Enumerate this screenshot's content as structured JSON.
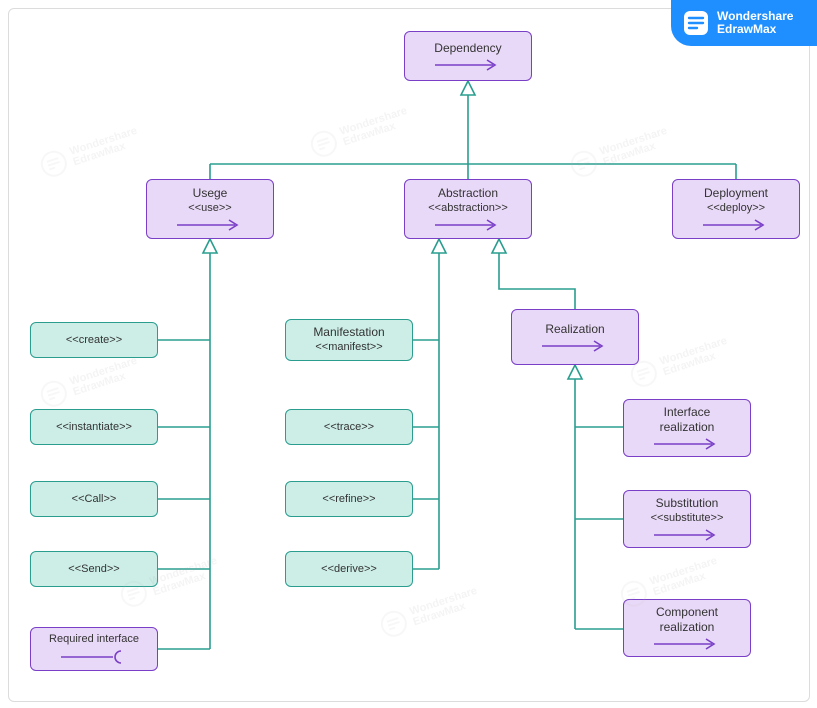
{
  "brand": {
    "line1": "Wondershare",
    "line2": "EdrawMax"
  },
  "watermark": {
    "line1": "Wondershare",
    "line2": "EdrawMax"
  },
  "colors": {
    "purpleFill": "#e9d9f8",
    "purpleStroke": "#7a3fc7",
    "tealFill": "#cceee7",
    "tealStroke": "#2a9d8f"
  },
  "nodes": {
    "dependency": {
      "title": "Dependency",
      "arrow": "solid-purple"
    },
    "usage": {
      "title": "Usege",
      "stereo": "<<use>>",
      "arrow": "solid-purple"
    },
    "abstraction": {
      "title": "Abstraction",
      "stereo": "<<abstraction>>",
      "arrow": "solid-purple"
    },
    "deployment": {
      "title": "Deployment",
      "stereo": "<<deploy>>",
      "arrow": "solid-purple"
    },
    "create": {
      "stereo": "<<create>>"
    },
    "instantiate": {
      "stereo": "<<instantiate>>"
    },
    "call": {
      "stereo": "<<Call>>"
    },
    "send": {
      "stereo": "<<Send>>"
    },
    "reqiface": {
      "title": "Required interface",
      "arrow": "req-iface"
    },
    "manifest": {
      "title": "Manifestation",
      "stereo": "<<manifest>>"
    },
    "trace": {
      "stereo": "<<trace>>"
    },
    "refine": {
      "stereo": "<<refine>>"
    },
    "derive": {
      "stereo": "<<derive>>"
    },
    "realization": {
      "title": "Realization",
      "arrow": "solid-purple"
    },
    "ifacereal": {
      "title": "Interface\nrealization",
      "arrow": "solid-purple"
    },
    "subst": {
      "title": "Substitution",
      "stereo": "<<substitute>>",
      "arrow": "solid-purple"
    },
    "compreal": {
      "title": "Component\nrealization",
      "arrow": "solid-purple"
    }
  },
  "chart_data": {
    "type": "table",
    "diagram_kind": "uml-dependency-hierarchy",
    "root": "Dependency",
    "edges_generalization": [
      [
        "Usege",
        "Dependency"
      ],
      [
        "Abstraction",
        "Dependency"
      ],
      [
        "Deployment",
        "Dependency"
      ],
      [
        "<<create>>",
        "Usege"
      ],
      [
        "<<instantiate>>",
        "Usege"
      ],
      [
        "<<Call>>",
        "Usege"
      ],
      [
        "<<Send>>",
        "Usege"
      ],
      [
        "Required interface",
        "Usege"
      ],
      [
        "Manifestation <<manifest>>",
        "Abstraction"
      ],
      [
        "<<trace>>",
        "Abstraction"
      ],
      [
        "<<refine>>",
        "Abstraction"
      ],
      [
        "<<derive>>",
        "Abstraction"
      ],
      [
        "Realization",
        "Abstraction"
      ],
      [
        "Interface realization",
        "Realization"
      ],
      [
        "Substitution <<substitute>>",
        "Realization"
      ],
      [
        "Component realization",
        "Realization"
      ]
    ],
    "node_styles": {
      "purple": [
        "Dependency",
        "Usege",
        "Abstraction",
        "Deployment",
        "Realization",
        "Interface realization",
        "Substitution <<substitute>>",
        "Component realization",
        "Required interface"
      ],
      "teal": [
        "<<create>>",
        "<<instantiate>>",
        "<<Call>>",
        "<<Send>>",
        "Manifestation <<manifest>>",
        "<<trace>>",
        "<<refine>>",
        "<<derive>>"
      ]
    }
  }
}
